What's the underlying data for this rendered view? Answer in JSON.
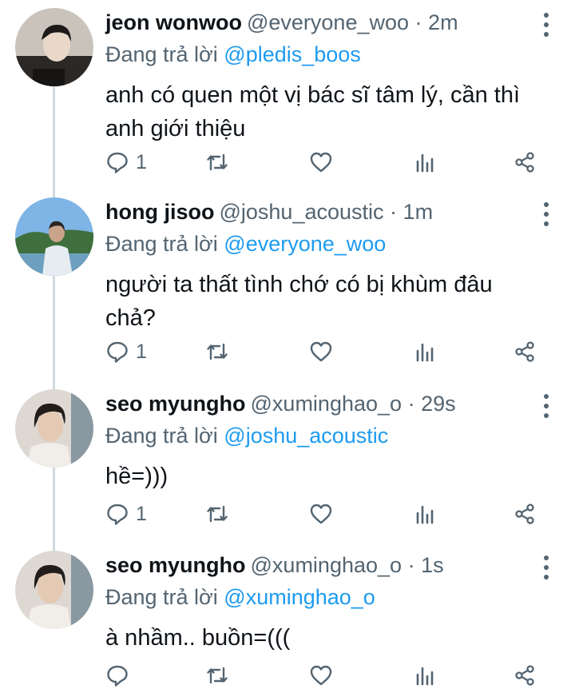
{
  "tweets": [
    {
      "name": "jeon wonwoo",
      "handle": "@everyone_woo",
      "separator": "·",
      "time": "2m",
      "reply_prefix": "Đang trả lời",
      "reply_to": "@pledis_boos",
      "text": "anh có quen một vị bác sĩ tâm lý, cần thì anh giới thiệu",
      "reply_count": "1"
    },
    {
      "name": "hong jisoo",
      "handle": "@joshu_acoustic",
      "separator": "·",
      "time": "1m",
      "reply_prefix": "Đang trả lời",
      "reply_to": "@everyone_woo",
      "text": "người ta thất tình chớ có bị khùm đâu chả?",
      "reply_count": "1"
    },
    {
      "name": "seo myungho",
      "handle": "@xuminghao_o",
      "separator": "·",
      "time": "29s",
      "reply_prefix": "Đang trả lời",
      "reply_to": "@joshu_acoustic",
      "text": "hề=)))",
      "reply_count": "1"
    },
    {
      "name": "seo myungho",
      "handle": "@xuminghao_o",
      "separator": "·",
      "time": "1s",
      "reply_prefix": "Đang trả lời",
      "reply_to": "@xuminghao_o",
      "text": "à nhầm.. buồn=(((",
      "reply_count": ""
    }
  ],
  "icons": {
    "reply": "reply-icon",
    "retweet": "retweet-icon",
    "like": "heart-icon",
    "stats": "stats-icon",
    "share": "share-icon",
    "more": "more-vertical-icon"
  },
  "colors": {
    "link": "#1d9bf0",
    "secondary_text": "#536471",
    "thread_line": "#cfd9de"
  }
}
